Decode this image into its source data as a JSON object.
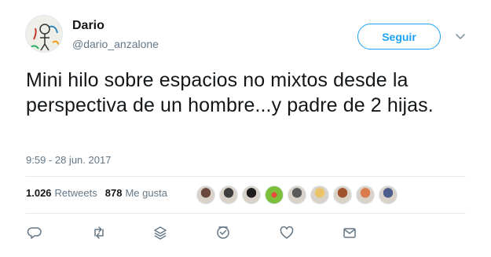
{
  "user": {
    "name": "Dario",
    "handle": "@dario_anzalone"
  },
  "follow_button": {
    "label": "Seguir"
  },
  "tweet": {
    "text": "Mini hilo sobre espacios no mixtos desde la perspectiva de un hombre...y padre de 2 hijas.",
    "timestamp": "9:59 - 28 jun. 2017"
  },
  "stats": {
    "retweets_count": "1.026",
    "retweets_label": "Retweets",
    "likes_count": "878",
    "likes_label": "Me gusta"
  },
  "liker_avatars": [
    {
      "color": "#6b4a3e"
    },
    {
      "color": "#3d3d3d"
    },
    {
      "color": "#1f1f1f"
    },
    {
      "color": "#7bbf3a"
    },
    {
      "color": "#5a5a5a"
    },
    {
      "color": "#e9c46a"
    },
    {
      "color": "#a0522d"
    },
    {
      "color": "#d97b4a"
    },
    {
      "color": "#4b5d8a"
    }
  ],
  "actions": [
    {
      "icon": "reply-icon"
    },
    {
      "icon": "retweet-icon"
    },
    {
      "icon": "stack-icon"
    },
    {
      "icon": "moment-icon"
    },
    {
      "icon": "like-icon"
    },
    {
      "icon": "direct-message-icon"
    }
  ],
  "colors": {
    "accent": "#1da1f2",
    "text_primary": "#14171a",
    "text_secondary": "#657786",
    "divider": "#e6ecf0"
  }
}
